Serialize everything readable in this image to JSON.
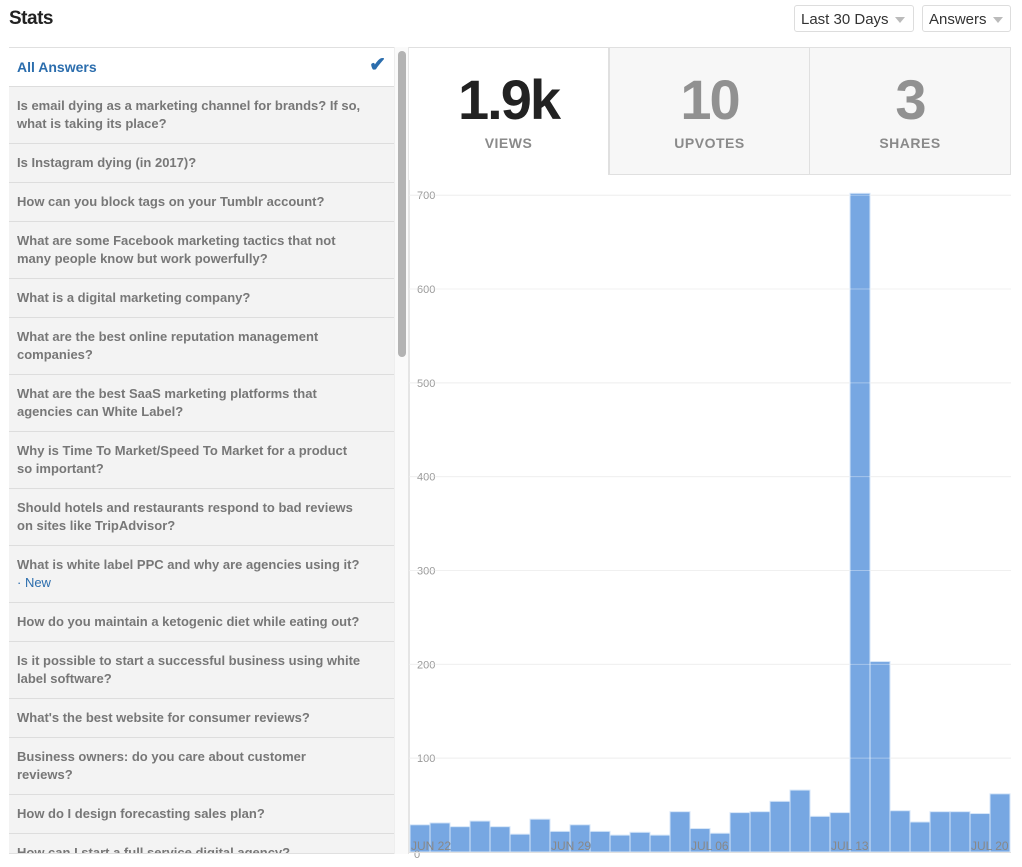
{
  "header": {
    "title": "Stats",
    "range_dropdown": "Last 30 Days",
    "type_dropdown": "Answers"
  },
  "list": {
    "selected": "All Answers",
    "items": [
      {
        "text": "Is email dying as a marketing channel for brands? If so, what is taking its place?"
      },
      {
        "text": "Is Instagram dying (in 2017)?"
      },
      {
        "text": "How can you block tags on your Tumblr account?"
      },
      {
        "text": "What are some Facebook marketing tactics that not many people know but work powerfully?"
      },
      {
        "text": "What is a digital marketing company?"
      },
      {
        "text": "What are the best online reputation management companies?"
      },
      {
        "text": "What are the best SaaS marketing platforms that agencies can White Label?"
      },
      {
        "text": "Why is Time To Market/Speed To Market for a product so important?"
      },
      {
        "text": "Should hotels and restaurants respond to bad reviews on sites like TripAdvisor?"
      },
      {
        "text": "What is white label PPC and why are agencies using it?",
        "badge": "· New"
      },
      {
        "text": "How do you maintain a ketogenic diet while eating out?"
      },
      {
        "text": "Is it possible to start a successful business using white label software?"
      },
      {
        "text": "What's the best website for consumer reviews?"
      },
      {
        "text": "Business owners: do you care about customer reviews?"
      },
      {
        "text": "How do I design forecasting sales plan?"
      },
      {
        "text": "How can I start a full service digital agency?"
      }
    ]
  },
  "tabs": [
    {
      "value": "1.9k",
      "label": "VIEWS",
      "active": true
    },
    {
      "value": "10",
      "label": "UPVOTES",
      "active": false
    },
    {
      "value": "3",
      "label": "SHARES",
      "active": false
    }
  ],
  "colors": {
    "accent": "#2b6dad",
    "bar": "#77a7e2"
  },
  "chart_data": {
    "type": "bar",
    "title": "",
    "xlabel": "",
    "ylabel": "",
    "ylim": [
      0,
      720
    ],
    "yticks": [
      0,
      100,
      200,
      300,
      400,
      500,
      600,
      700
    ],
    "grid": true,
    "x_tick_labels": [
      {
        "index": 0,
        "label": "JUN 22"
      },
      {
        "index": 7,
        "label": "JUN 29"
      },
      {
        "index": 14,
        "label": "JUL 06"
      },
      {
        "index": 21,
        "label": "JUL 13"
      },
      {
        "index": 28,
        "label": "JUL 20"
      }
    ],
    "categories": [
      "Jun 22",
      "Jun 23",
      "Jun 24",
      "Jun 25",
      "Jun 26",
      "Jun 27",
      "Jun 28",
      "Jun 29",
      "Jun 30",
      "Jul 01",
      "Jul 02",
      "Jul 03",
      "Jul 04",
      "Jul 05",
      "Jul 06",
      "Jul 07",
      "Jul 08",
      "Jul 09",
      "Jul 10",
      "Jul 11",
      "Jul 12",
      "Jul 13",
      "Jul 14",
      "Jul 15",
      "Jul 16",
      "Jul 17",
      "Jul 18",
      "Jul 19",
      "Jul 20",
      "Jul 21"
    ],
    "values": [
      29,
      31,
      27,
      33,
      27,
      19,
      35,
      22,
      29,
      22,
      18,
      21,
      18,
      43,
      25,
      20,
      42,
      43,
      54,
      66,
      38,
      42,
      702,
      203,
      44,
      32,
      43,
      43,
      41,
      62
    ]
  }
}
